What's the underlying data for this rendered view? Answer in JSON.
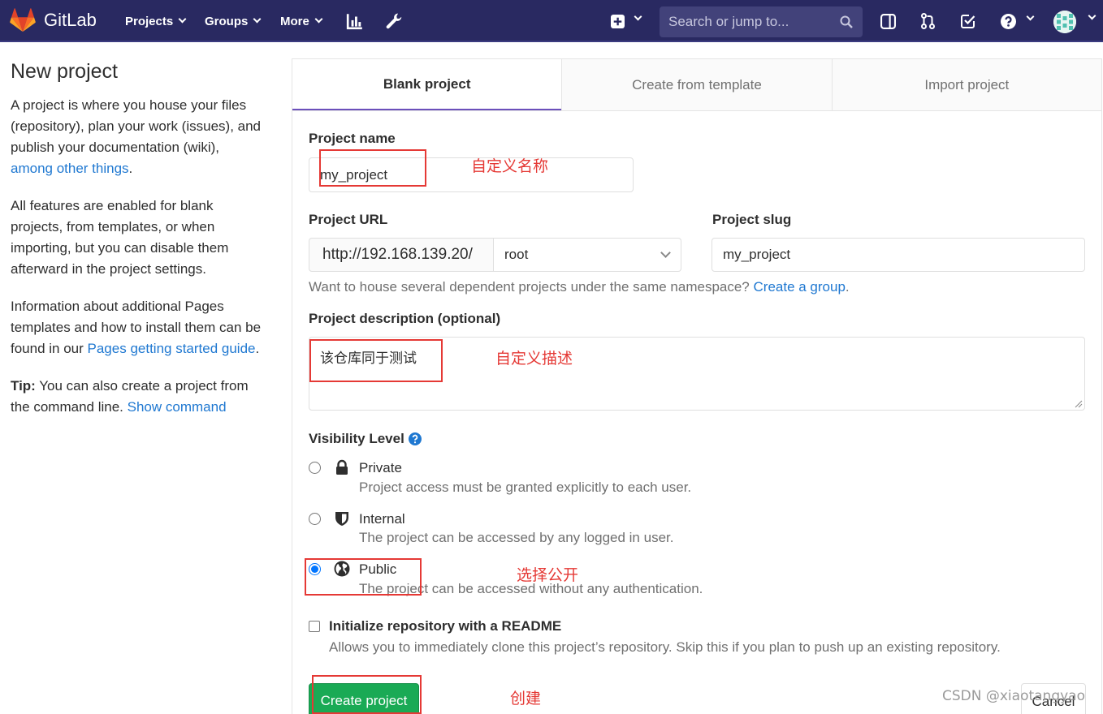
{
  "navbar": {
    "brand": "GitLab",
    "menu": [
      {
        "label": "Projects"
      },
      {
        "label": "Groups"
      },
      {
        "label": "More"
      }
    ],
    "icons": [
      "chart-icon",
      "wrench-icon",
      "plus-square-icon",
      "sidebar-icon",
      "merge-request-icon",
      "todo-check-icon",
      "help-icon"
    ],
    "search_placeholder": "Search or jump to...",
    "bg_color": "#292961"
  },
  "left": {
    "title": "New project",
    "p1_text": "A project is where you house your files (repository), plan your work (issues), and publish your documentation (wiki), ",
    "p1_link": "among other things",
    "p1_end": ".",
    "p2_text": "All features are enabled for blank projects, from templates, or when importing, but you can disable them afterward in the project settings.",
    "p3_text": "Information about additional Pages templates and how to install them can be found in our ",
    "p3_link": "Pages getting started guide",
    "p3_end": ".",
    "tip_bold": "Tip:",
    "tip_text": " You can also create a project from the command line. ",
    "tip_link": "Show command"
  },
  "tabs": [
    {
      "label": "Blank project",
      "active": true
    },
    {
      "label": "Create from template",
      "active": false
    },
    {
      "label": "Import project",
      "active": false
    }
  ],
  "form": {
    "project_name_label": "Project name",
    "project_name_value": "my_project",
    "project_url_label": "Project URL",
    "url_prefix": "http://192.168.139.20/",
    "namespace_value": "root",
    "slug_label": "Project slug",
    "slug_value": "my_project",
    "namespace_help": "Want to house several dependent projects under the same namespace? ",
    "namespace_help_link": "Create a group",
    "namespace_help_end": ".",
    "description_label": "Project description (optional)",
    "description_value": "该仓库同于测试",
    "visibility_label": "Visibility Level",
    "visibility_options": [
      {
        "title": "Private",
        "desc": "Project access must be granted explicitly to each user.",
        "icon": "lock-icon",
        "checked": false
      },
      {
        "title": "Internal",
        "desc": "The project can be accessed by any logged in user.",
        "icon": "shield-icon",
        "checked": false
      },
      {
        "title": "Public",
        "desc": "The project can be accessed without any authentication.",
        "icon": "globe-icon",
        "checked": true
      }
    ],
    "readme_label": "Initialize repository with a README",
    "readme_desc": "Allows you to immediately clone this project’s repository. Skip this if you plan to push up an existing repository.",
    "readme_checked": false,
    "create_button": "Create project",
    "cancel_button": "Cancel"
  },
  "annotations": {
    "name_note": "自定义名称",
    "desc_note": "自定义描述",
    "public_note": "选择公开",
    "create_note": "创建",
    "color": "#e53935"
  },
  "watermark": "CSDN @xiaotangyao"
}
